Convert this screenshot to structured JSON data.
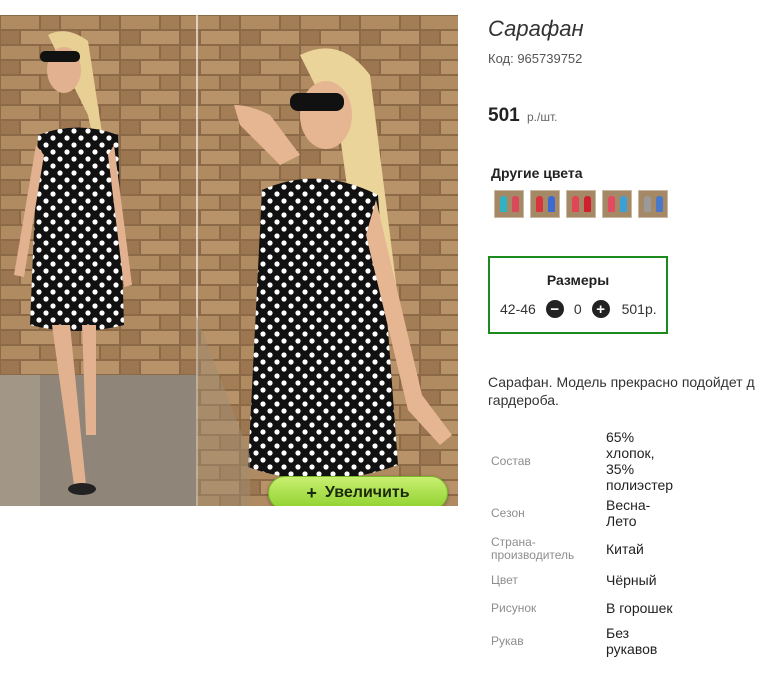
{
  "product": {
    "title": "Сарафан",
    "code": "Код: 965739752",
    "price": "501",
    "price_unit": "р./шт.",
    "zoom_label": "Увеличить",
    "zoom_plus": "+"
  },
  "colors": {
    "heading": "Другие цвета",
    "swatches": [
      {
        "a": "#2fb3c4",
        "b": "#d84a5a"
      },
      {
        "a": "#d8343c",
        "b": "#3c6ad0"
      },
      {
        "a": "#e04656",
        "b": "#d02030"
      },
      {
        "a": "#e24a60",
        "b": "#3aa0d8"
      },
      {
        "a": "#9a9a9a",
        "b": "#4a78c8"
      }
    ]
  },
  "sizes": {
    "title": "Размеры",
    "size": "42-46",
    "qty": "0",
    "price": "501р.",
    "minus": "−",
    "plus": "+"
  },
  "description": {
    "line1": "Сарафан. Модель прекрасно подойдет д",
    "line2": "гардероба."
  },
  "properties": [
    {
      "key": "Состав",
      "value": [
        "65%",
        "хлопок,",
        "35%",
        "полиэстер"
      ]
    },
    {
      "key": "Сезон",
      "value": [
        "Весна-",
        "Лето"
      ]
    },
    {
      "key": [
        "Страна-",
        "производитель"
      ],
      "value": [
        "Китай"
      ]
    },
    {
      "key": "Цвет",
      "value": [
        "Чёрный"
      ]
    },
    {
      "key": "Рисунок",
      "value": [
        "В горошек"
      ]
    },
    {
      "key": "Рукав",
      "value": [
        "Без",
        "рукавов"
      ]
    }
  ]
}
